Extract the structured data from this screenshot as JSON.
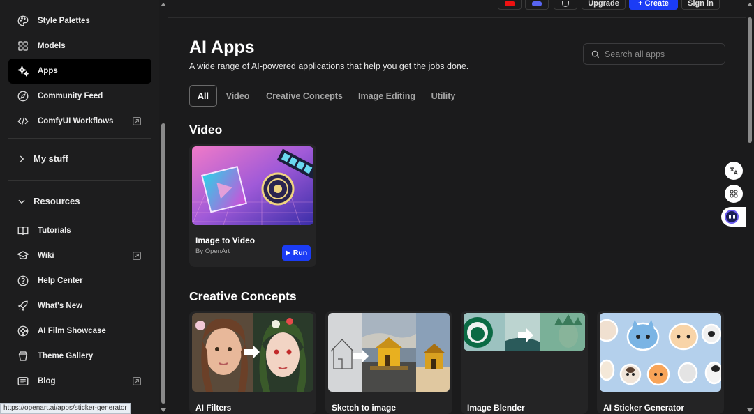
{
  "sidebar": {
    "items": [
      {
        "label": "Style Palettes",
        "icon": "palette-icon"
      },
      {
        "label": "Models",
        "icon": "grid-icon"
      },
      {
        "label": "Apps",
        "icon": "sparkle-icon"
      },
      {
        "label": "Community Feed",
        "icon": "compass-icon"
      },
      {
        "label": "ComfyUI Workflows",
        "icon": "code-icon"
      }
    ],
    "my_stuff": "My stuff",
    "resources": "Resources",
    "resource_items": [
      {
        "label": "Tutorials",
        "icon": "book-icon"
      },
      {
        "label": "Wiki",
        "icon": "graduation-cap-icon"
      },
      {
        "label": "Help Center",
        "icon": "help-circle-icon"
      },
      {
        "label": "What's New",
        "icon": "rocket-icon"
      },
      {
        "label": "AI Film Showcase",
        "icon": "film-reel-icon"
      },
      {
        "label": "Theme Gallery",
        "icon": "gallery-icon"
      },
      {
        "label": "Blog",
        "icon": "newspaper-icon"
      }
    ]
  },
  "topbar": {
    "upgrade_label": "Upgrade",
    "create_label": "+ Create",
    "signin_label": "Sign in"
  },
  "main": {
    "title": "AI Apps",
    "subtitle": "A wide range of AI-powered applications that help you get the jobs done.",
    "search_placeholder": "Search all apps",
    "tabs": [
      "All",
      "Video",
      "Creative Concepts",
      "Image Editing",
      "Utility"
    ],
    "sections": {
      "video": {
        "title": "Video",
        "cards": [
          {
            "title": "Image to Video",
            "by": "By OpenArt",
            "run": "Run"
          }
        ]
      },
      "creative": {
        "title": "Creative Concepts",
        "cards": [
          {
            "title": "AI Filters"
          },
          {
            "title": "Sketch to image"
          },
          {
            "title": "Image Blender"
          },
          {
            "title": "AI Sticker Generator"
          }
        ]
      }
    }
  },
  "status_url": "https://openart.ai/apps/sticker-generator",
  "colors": {
    "accent": "#1b3cf5",
    "background": "#1b1b1c"
  }
}
